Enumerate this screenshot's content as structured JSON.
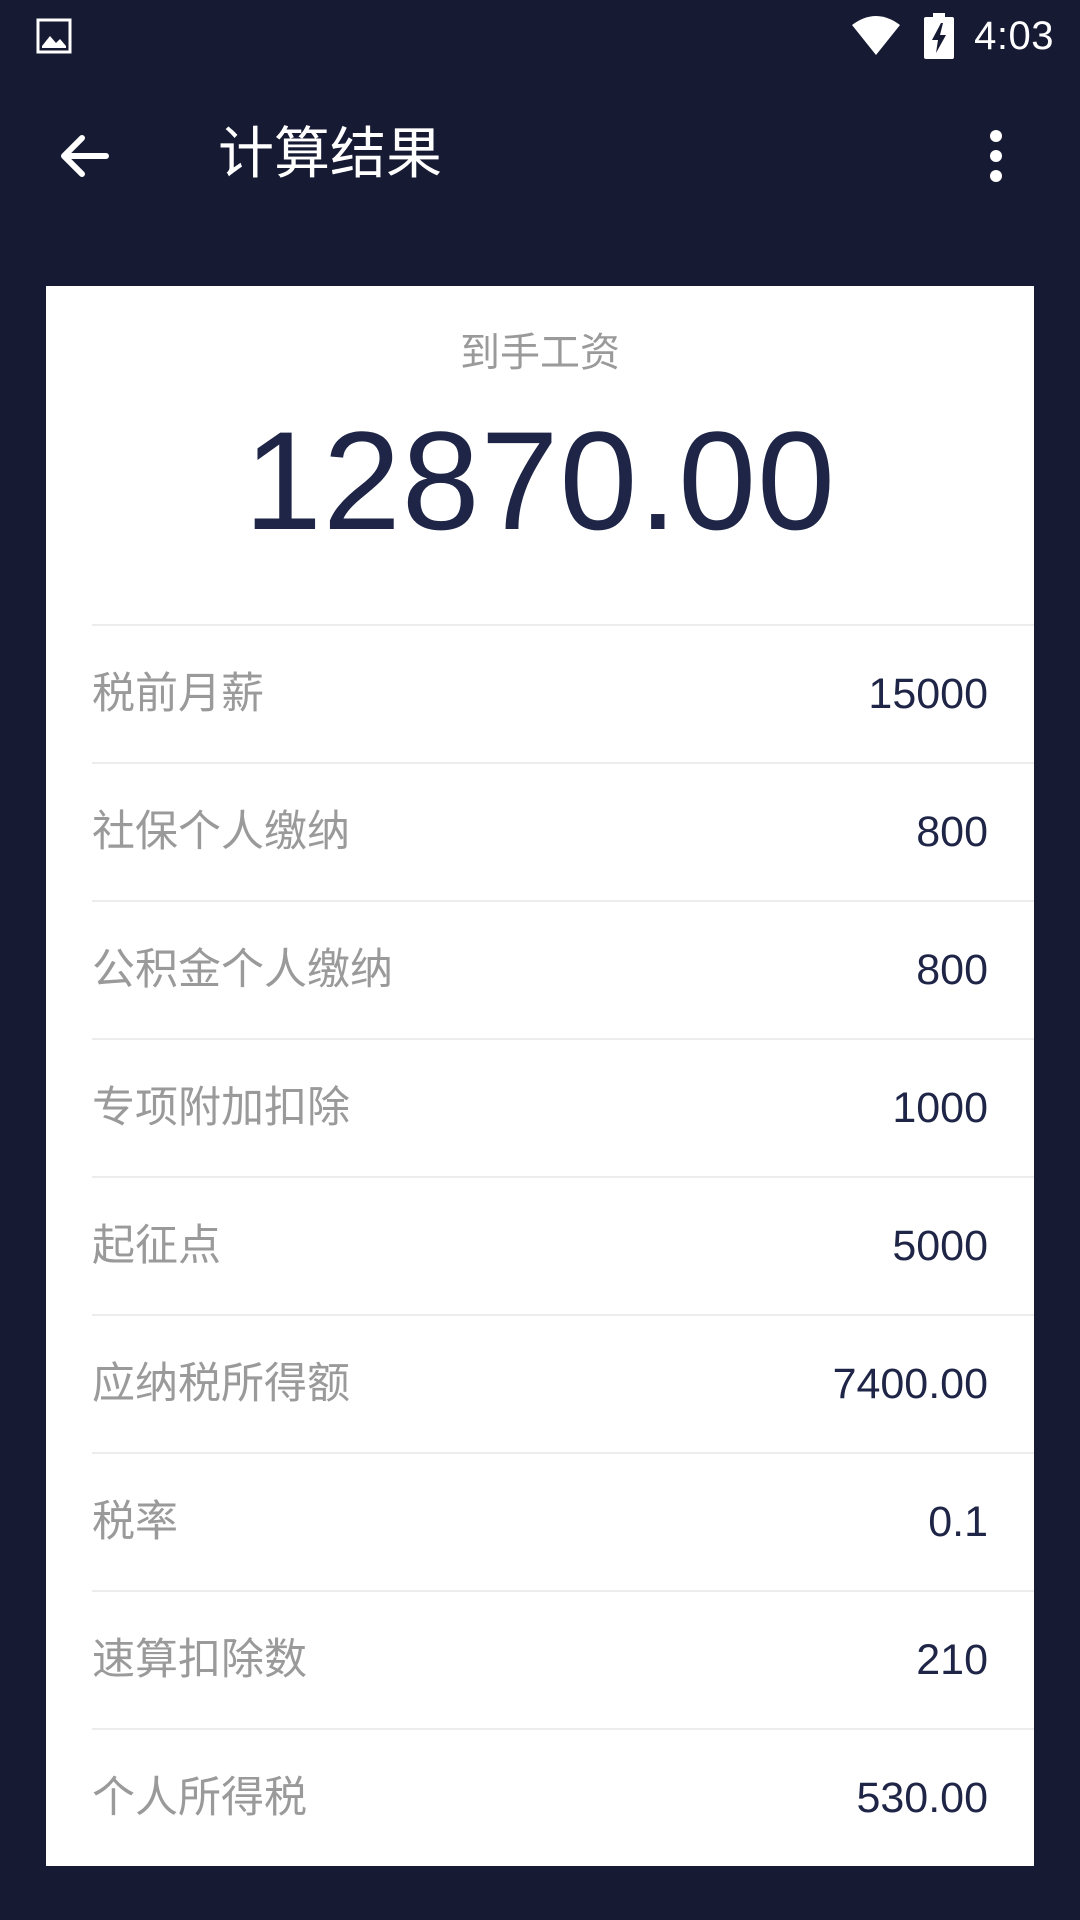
{
  "status_bar": {
    "time": "4:03",
    "icons": [
      "image-icon",
      "wifi-icon",
      "battery-charging-icon"
    ]
  },
  "app_bar": {
    "title": "计算结果",
    "back_icon": "arrow-left-icon",
    "more_icon": "more-vert-icon"
  },
  "result": {
    "label": "到手工资",
    "value": "12870.00",
    "rows": [
      {
        "label": "税前月薪",
        "value": "15000"
      },
      {
        "label": "社保个人缴纳",
        "value": "800"
      },
      {
        "label": "公积金个人缴纳",
        "value": "800"
      },
      {
        "label": "专项附加扣除",
        "value": "1000"
      },
      {
        "label": "起征点",
        "value": "5000"
      },
      {
        "label": "应纳税所得额",
        "value": "7400.00"
      },
      {
        "label": "税率",
        "value": "0.1"
      },
      {
        "label": "速算扣除数",
        "value": "210"
      },
      {
        "label": "个人所得税",
        "value": "530.00"
      }
    ]
  },
  "colors": {
    "background": "#161a33",
    "card": "#ffffff",
    "value_text": "#1f2546",
    "label_text": "#9a9a9a",
    "divider": "#ececec"
  }
}
